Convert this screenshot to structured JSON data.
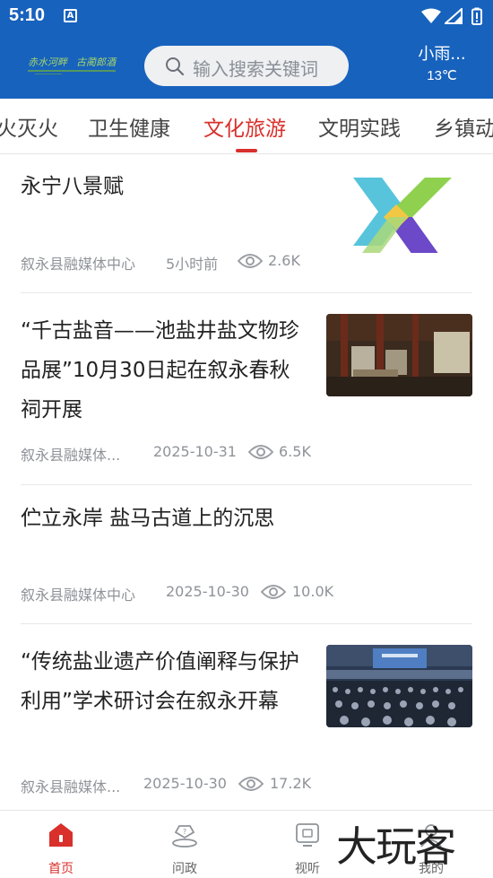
{
  "status_bar": {
    "time": "5:10",
    "notification_icon": "A"
  },
  "header": {
    "logo_text": "赤水河畔 古蔺郎酒",
    "search_placeholder": "输入搜索关键词",
    "weather_condition": "小雨...",
    "weather_temp": "13℃"
  },
  "tabs": [
    {
      "label": "火灭火"
    },
    {
      "label": "卫生健康"
    },
    {
      "label": "文化旅游",
      "active": true
    },
    {
      "label": "文明实践"
    },
    {
      "label": "乡镇动"
    }
  ],
  "feed": [
    {
      "title": "永宁八景赋",
      "source": "叙永县融媒体中心",
      "time": "5小时前",
      "views": "2.6K",
      "thumb": "x-logo"
    },
    {
      "title": "“千古盐音——池盐井盐文物珍品展”10月30日起在叙永春秋祠开展",
      "source": "叙永县融媒体...",
      "time": "2025-10-31",
      "views": "6.5K",
      "thumb": "exhibition-hall"
    },
    {
      "title": "伫立永岸 盐马古道上的沉思",
      "source": "叙永县融媒体中心",
      "time": "2025-10-30",
      "views": "10.0K"
    },
    {
      "title": "“传统盐业遗产价值阐释与保护利用”学术研讨会在叙永开幕",
      "source": "叙永县融媒体...",
      "time": "2025-10-30",
      "views": "17.2K",
      "thumb": "conference-hall"
    }
  ],
  "bottom_nav": [
    {
      "label": "首页",
      "icon": "home-icon",
      "active": true
    },
    {
      "label": "问政",
      "icon": "question-icon"
    },
    {
      "label": "视听",
      "icon": "tv-icon"
    },
    {
      "label": "我的",
      "icon": "user-icon"
    }
  ],
  "watermark": "大玩客",
  "colors": {
    "brand_blue": "#1762bd",
    "accent_red": "#d9302c"
  }
}
